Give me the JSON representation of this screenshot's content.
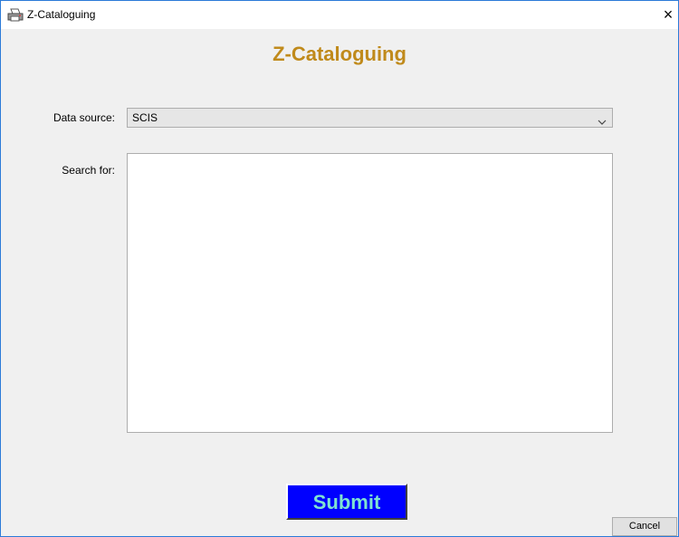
{
  "window": {
    "title": "Z-Cataloguing",
    "close_glyph": "×",
    "app_icon": "printer-icon"
  },
  "form": {
    "heading": "Z-Cataloguing",
    "data_source_label": "Data source:",
    "data_source_value": "SCIS",
    "search_label": "Search for:",
    "search_value": ""
  },
  "buttons": {
    "submit": "Submit",
    "cancel": "Cancel"
  },
  "colors": {
    "heading": "#c08a1b",
    "submit_bg": "#0000ff",
    "submit_text": "#7fe3d1",
    "window_border": "#2b7ad8"
  }
}
